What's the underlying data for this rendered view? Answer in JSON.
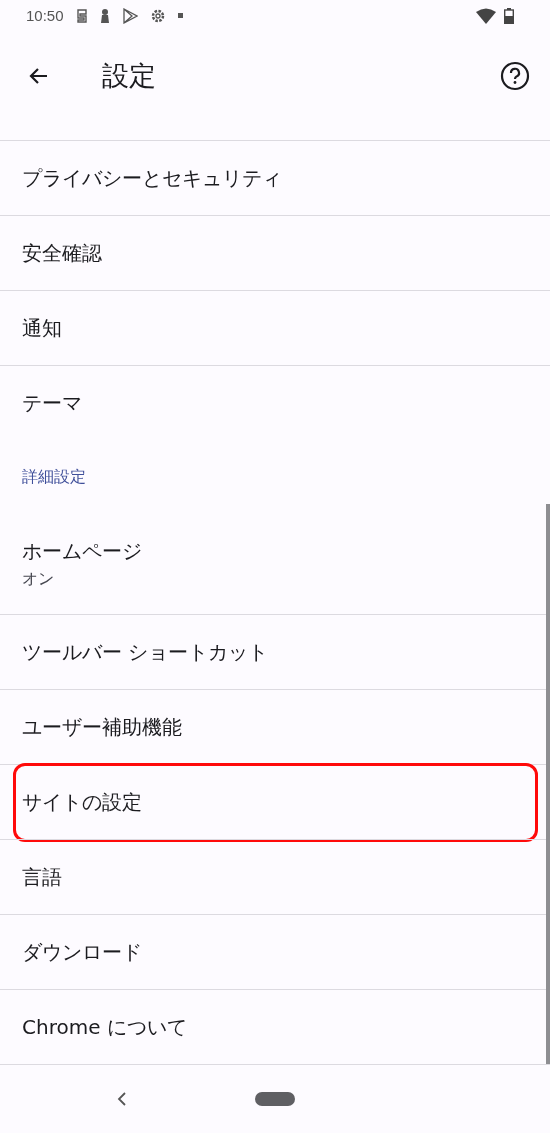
{
  "status_bar": {
    "time": "10:50"
  },
  "toolbar": {
    "title": "設定"
  },
  "sections": [
    {
      "items": [
        {
          "title": "プライバシーとセキュリティ",
          "highlighted": false
        },
        {
          "title": "安全確認",
          "highlighted": false
        },
        {
          "title": "通知",
          "highlighted": false
        },
        {
          "title": "テーマ",
          "highlighted": false
        }
      ]
    },
    {
      "header": "詳細設定",
      "items": [
        {
          "title": "ホームページ",
          "summary": "オン",
          "highlighted": false
        },
        {
          "title": "ツールバー ショートカット",
          "highlighted": false
        },
        {
          "title": "ユーザー補助機能",
          "highlighted": false
        },
        {
          "title": "サイトの設定",
          "highlighted": true
        },
        {
          "title": "言語",
          "highlighted": false
        },
        {
          "title": "ダウンロード",
          "highlighted": false
        },
        {
          "title": "Chrome について",
          "highlighted": false
        }
      ]
    }
  ]
}
